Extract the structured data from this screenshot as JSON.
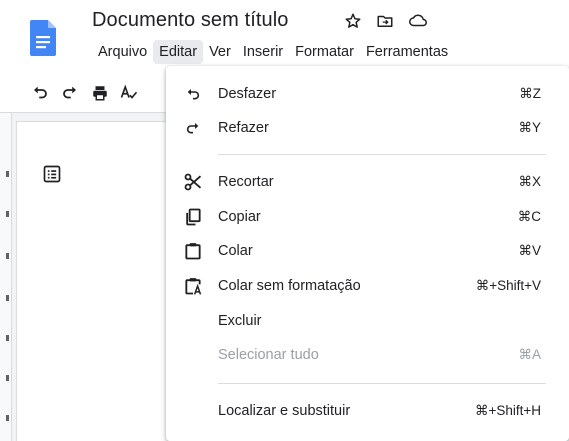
{
  "document": {
    "title": "Documento sem título"
  },
  "menubar": {
    "items": [
      "Arquivo",
      "Editar",
      "Ver",
      "Inserir",
      "Formatar",
      "Ferramentas"
    ],
    "active_index": 1
  },
  "edit_menu": {
    "items": [
      {
        "label": "Desfazer",
        "shortcut": "⌘Z",
        "icon": "undo-icon",
        "enabled": true
      },
      {
        "label": "Refazer",
        "shortcut": "⌘Y",
        "icon": "redo-icon",
        "enabled": true
      },
      {
        "label": "Recortar",
        "shortcut": "⌘X",
        "icon": "scissors-icon",
        "enabled": true
      },
      {
        "label": "Copiar",
        "shortcut": "⌘C",
        "icon": "copy-icon",
        "enabled": true
      },
      {
        "label": "Colar",
        "shortcut": "⌘V",
        "icon": "paste-icon",
        "enabled": true
      },
      {
        "label": "Colar sem formatação",
        "shortcut": "⌘+Shift+V",
        "icon": "paste-plain-icon",
        "enabled": true
      },
      {
        "label": "Excluir",
        "shortcut": "",
        "icon": "",
        "enabled": true
      },
      {
        "label": "Selecionar tudo",
        "shortcut": "⌘A",
        "icon": "",
        "enabled": false
      },
      {
        "label": "Localizar e substituir",
        "shortcut": "⌘+Shift+H",
        "icon": "",
        "enabled": true
      }
    ]
  },
  "toolbar": {
    "icons": [
      "undo-icon",
      "redo-icon",
      "print-icon",
      "spellcheck-icon"
    ]
  },
  "colors": {
    "docs_blue": "#4285f4",
    "menu_active_bg": "#e8eaed",
    "disabled_text": "#9aa0a6"
  }
}
